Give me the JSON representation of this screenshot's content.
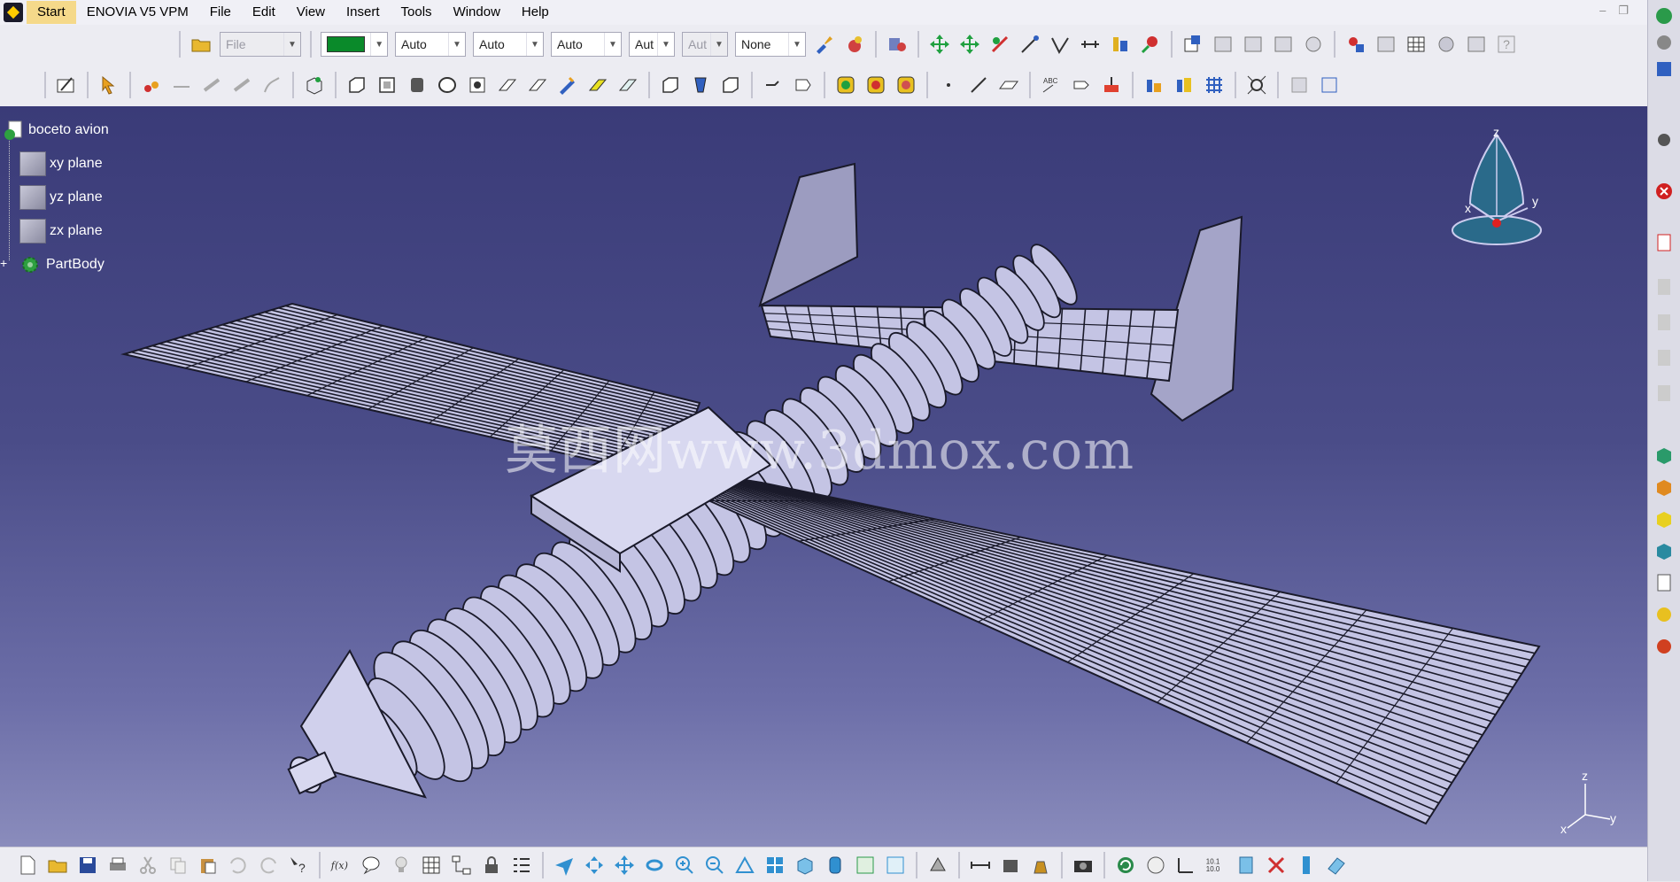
{
  "menubar": {
    "items": [
      {
        "id": "start",
        "label": "Start"
      },
      {
        "id": "enovia",
        "label": "ENOVIA V5 VPM"
      },
      {
        "id": "file",
        "label": "File"
      },
      {
        "id": "edit",
        "label": "Edit"
      },
      {
        "id": "view",
        "label": "View"
      },
      {
        "id": "insert",
        "label": "Insert"
      },
      {
        "id": "tools",
        "label": "Tools"
      },
      {
        "id": "window",
        "label": "Window"
      },
      {
        "id": "help",
        "label": "Help"
      }
    ]
  },
  "toolbar1": {
    "file_combo": "File",
    "color_value": "#0a8a2a",
    "combo_auto1": "Auto",
    "combo_auto2": "Auto",
    "combo_auto3": "Auto",
    "combo_aut4": "Aut",
    "combo_aut5": "Aut",
    "combo_none": "None"
  },
  "tree": {
    "root": "boceto avion",
    "children": [
      "xy plane",
      "yz plane",
      "zx plane"
    ],
    "body": "PartBody"
  },
  "watermark": "莫西网www.3dmox.com",
  "compass": {
    "x_label": "x",
    "y_label": "y",
    "z_label": "z"
  },
  "mini_axes": {
    "x": "x",
    "y": "y",
    "z": "z"
  },
  "bottom_labels": {
    "fx": "f(x)",
    "ratio_top": "10.1",
    "ratio_bottom": "10.0"
  },
  "colors": {
    "viewport_top": "#3a3b78",
    "viewport_bottom": "#8a8cbc",
    "model_fill": "#c4c4e4",
    "model_stroke": "#1a1a2a"
  }
}
